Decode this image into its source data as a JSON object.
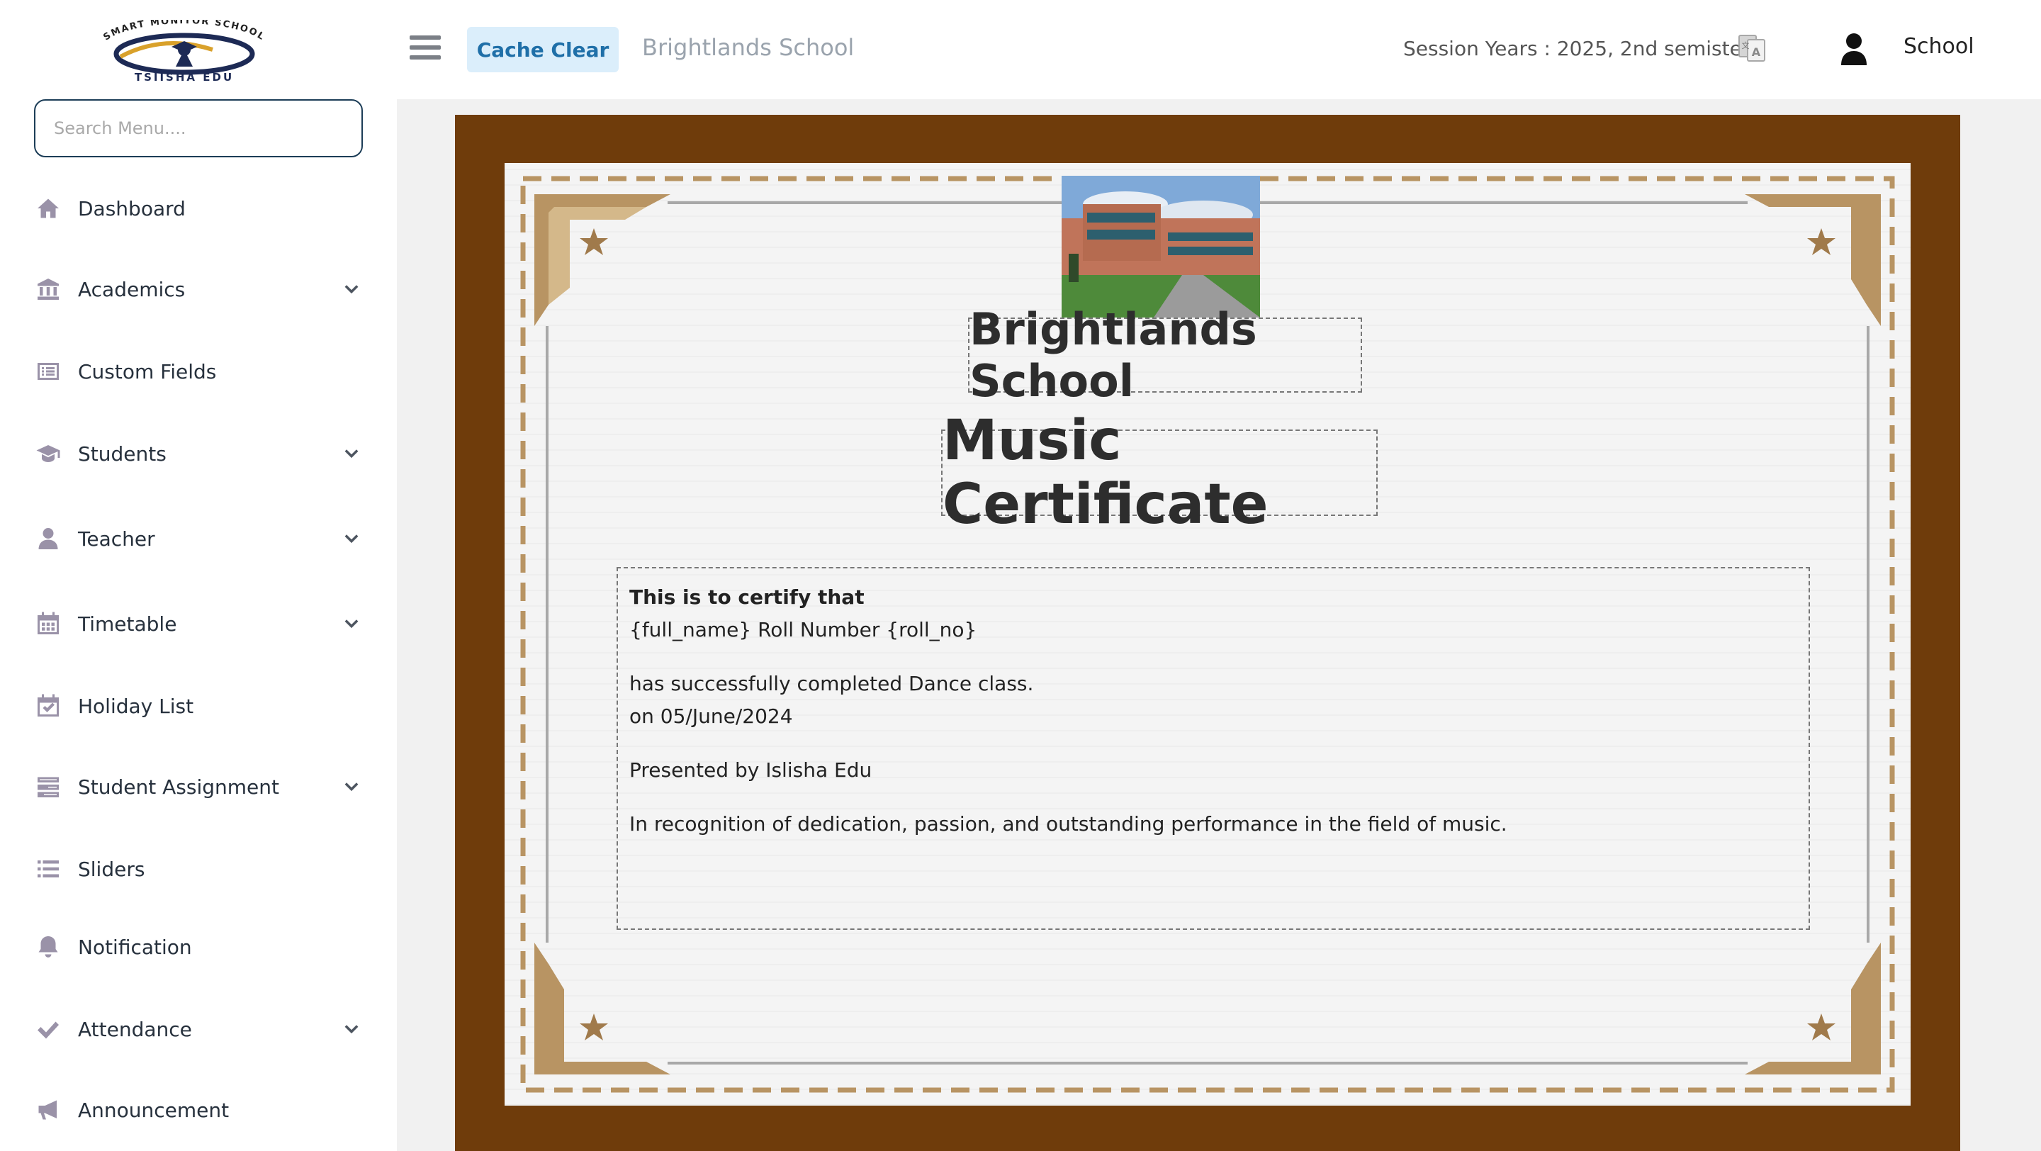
{
  "logo": {
    "top_text": "SMART MONITOR SCHOOL",
    "bottom_text": "TSIISHA EDU"
  },
  "search": {
    "placeholder": "Search Menu...."
  },
  "sidebar": {
    "items": [
      {
        "label": "Dashboard",
        "icon": "home-icon",
        "expandable": false
      },
      {
        "label": "Academics",
        "icon": "institution-icon",
        "expandable": true
      },
      {
        "label": "Custom Fields",
        "icon": "list-alt-icon",
        "expandable": false
      },
      {
        "label": "Students",
        "icon": "graduation-cap-icon",
        "expandable": true
      },
      {
        "label": "Teacher",
        "icon": "user-icon",
        "expandable": true
      },
      {
        "label": "Timetable",
        "icon": "calendar-icon",
        "expandable": true
      },
      {
        "label": "Holiday List",
        "icon": "calendar-check-icon",
        "expandable": false
      },
      {
        "label": "Student Assignment",
        "icon": "tasks-icon",
        "expandable": true
      },
      {
        "label": "Sliders",
        "icon": "list-icon",
        "expandable": false
      },
      {
        "label": "Notification",
        "icon": "bell-icon",
        "expandable": false
      },
      {
        "label": "Attendance",
        "icon": "check-icon",
        "expandable": true
      },
      {
        "label": "Announcement",
        "icon": "bullhorn-icon",
        "expandable": false
      }
    ]
  },
  "header": {
    "cache_clear_label": "Cache Clear",
    "school_name": "Brightlands School",
    "session": "Session Years : 2025, 2nd semister",
    "user_label": "School"
  },
  "certificate": {
    "school_name": "Brightlands School",
    "title": "Music Certificate",
    "line_certify": "This is to certify that",
    "line_name": "{full_name} Roll Number {roll_no}",
    "line_completed": "has successfully completed Dance class.",
    "line_date": "on 05/June/2024",
    "line_presented": "Presented by Islisha Edu",
    "line_recognition": "In recognition of dedication, passion, and outstanding performance in the field of music."
  },
  "colors": {
    "frame_brown": "#6f3c0b",
    "corner_gold": "#b89463",
    "cache_button_bg": "#dbeefb",
    "cache_button_text": "#1f6fa8",
    "sidebar_icon": "#9a92a8"
  }
}
